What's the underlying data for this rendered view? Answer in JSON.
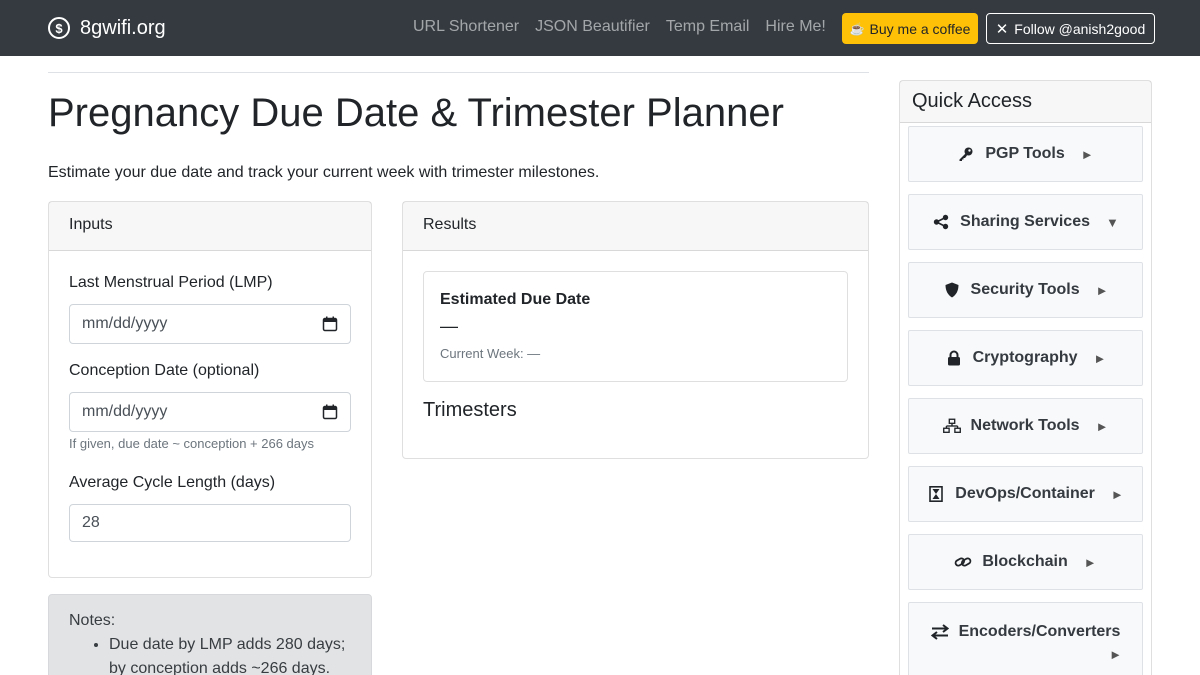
{
  "navbar": {
    "brand": "8gwifi.org",
    "brand_logo_glyph": "$",
    "links": [
      "URL Shortener",
      "JSON Beautifier",
      "Temp Email",
      "Hire Me!"
    ],
    "coffee_label": "Buy me a coffee",
    "follow_label": "Follow @anish2good",
    "colors": {
      "background": "#343a40",
      "coffee": "#ffc107"
    }
  },
  "page": {
    "title": "Pregnancy Due Date & Trimester Planner",
    "lead": "Estimate your due date and track your current week with trimester milestones."
  },
  "inputs": {
    "header": "Inputs",
    "lmp_label": "Last Menstrual Period (LMP)",
    "lmp_placeholder": "mm/dd/yyyy",
    "conception_label": "Conception Date (optional)",
    "conception_placeholder": "mm/dd/yyyy",
    "conception_help": "If given, due date ~ conception + 266 days",
    "cycle_label": "Average Cycle Length (days)",
    "cycle_value": "28"
  },
  "notes": {
    "title": "Notes:",
    "items": [
      "Due date by LMP adds 280 days; by conception adds ~266 days."
    ]
  },
  "results": {
    "header": "Results",
    "due_title": "Estimated Due Date",
    "due_value": "—",
    "current_week": "Current Week: —",
    "trimesters_title": "Trimesters"
  },
  "sidebar": {
    "header": "Quick Access",
    "items": [
      {
        "label": "PGP Tools",
        "icon": "key-icon",
        "arrow": "►"
      },
      {
        "label": "Sharing Services",
        "icon": "share-icon",
        "arrow": "▼"
      },
      {
        "label": "Security Tools",
        "icon": "shield-icon",
        "arrow": "►"
      },
      {
        "label": "Cryptography",
        "icon": "lock-icon",
        "arrow": "►"
      },
      {
        "label": "Network Tools",
        "icon": "network-icon",
        "arrow": "►"
      },
      {
        "label": "DevOps/Container",
        "icon": "hourglass-icon",
        "arrow": "►"
      },
      {
        "label": "Blockchain",
        "icon": "link-icon",
        "arrow": "►"
      },
      {
        "label": "Encoders/Converters",
        "icon": "exchange-icon",
        "arrow": "►"
      }
    ]
  }
}
